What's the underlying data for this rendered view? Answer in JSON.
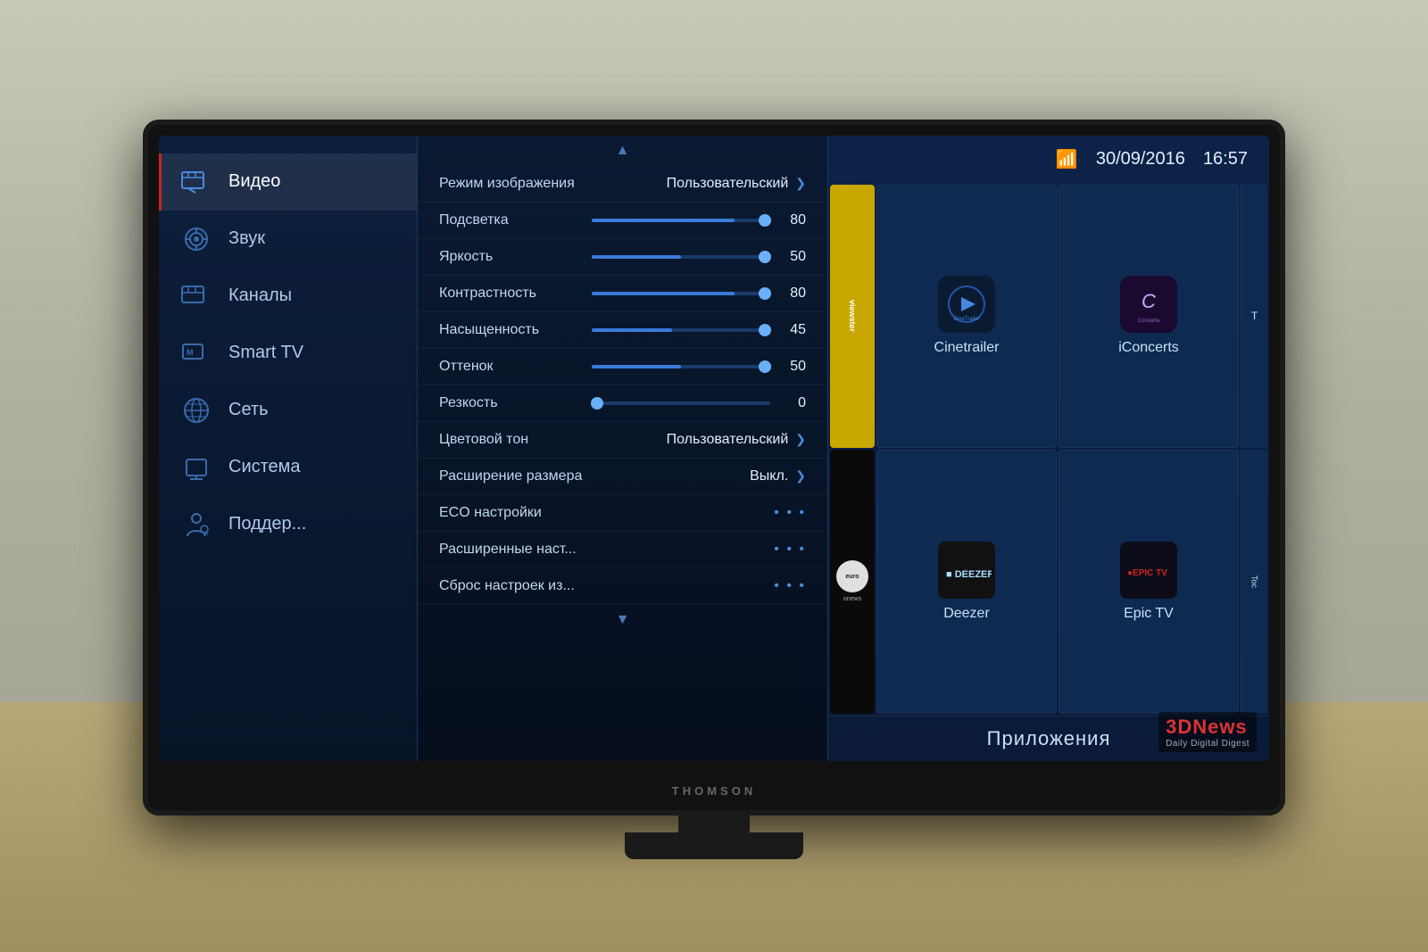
{
  "room": {
    "bg_color": "#9a9a8a",
    "table_color": "#b8a878"
  },
  "tv": {
    "brand": "THOMSON",
    "screen": {
      "sidebar": {
        "items": [
          {
            "id": "video",
            "label": "Видео",
            "active": true
          },
          {
            "id": "sound",
            "label": "Звук",
            "active": false
          },
          {
            "id": "channels",
            "label": "Каналы",
            "active": false
          },
          {
            "id": "smart_tv",
            "label": "Smart TV",
            "active": false
          },
          {
            "id": "network",
            "label": "Сеть",
            "active": false
          },
          {
            "id": "system",
            "label": "Система",
            "active": false
          },
          {
            "id": "support",
            "label": "Поддер...",
            "active": false
          }
        ]
      },
      "settings": {
        "scroll_up": "▲",
        "scroll_down": "▼",
        "items": [
          {
            "id": "image_mode",
            "label": "Режим изображения",
            "value": "Пользовательский",
            "type": "select"
          },
          {
            "id": "backlight",
            "label": "Подсветка",
            "value": "80",
            "type": "slider",
            "fill_pct": 80
          },
          {
            "id": "brightness",
            "label": "Яркость",
            "value": "50",
            "type": "slider",
            "fill_pct": 50
          },
          {
            "id": "contrast",
            "label": "Контрастность",
            "value": "80",
            "type": "slider",
            "fill_pct": 80
          },
          {
            "id": "saturation",
            "label": "Насыщенность",
            "value": "45",
            "type": "slider",
            "fill_pct": 45
          },
          {
            "id": "hue",
            "label": "Оттенок",
            "value": "50",
            "type": "slider",
            "fill_pct": 50
          },
          {
            "id": "sharpness",
            "label": "Резкость",
            "value": "0",
            "type": "slider",
            "fill_pct": 2
          },
          {
            "id": "color_tone",
            "label": "Цветовой тон",
            "value": "Пользовательский",
            "type": "select"
          },
          {
            "id": "size_ext",
            "label": "Расширение размера",
            "value": "Выкл.",
            "type": "select"
          },
          {
            "id": "eco",
            "label": "ECO настройки",
            "value": "...",
            "type": "dots"
          },
          {
            "id": "advanced",
            "label": "Расширенные наст...",
            "value": "...",
            "type": "dots"
          },
          {
            "id": "reset",
            "label": "Сброс настроек из...",
            "value": "...",
            "type": "dots"
          }
        ]
      },
      "smart": {
        "header": {
          "wifi": "📶",
          "date": "30/09/2016",
          "time": "16:57"
        },
        "apps_row1": [
          {
            "id": "viewster",
            "label": "viewster",
            "color": "#c8a800",
            "partial": false
          },
          {
            "id": "cinetrailer",
            "label": "Cinetrailer",
            "color": "#0a1a30"
          },
          {
            "id": "iconcerts",
            "label": "iConcerts",
            "color": "#1a0a30"
          },
          {
            "id": "partial_top",
            "label": "T",
            "partial": true
          }
        ],
        "apps_row2": [
          {
            "id": "euronews",
            "label": "euronews",
            "color": "#111"
          },
          {
            "id": "deezer",
            "label": "Deezer",
            "color": "#111"
          },
          {
            "id": "epictv",
            "label": "Epic TV",
            "color": "#0d0d1a"
          },
          {
            "id": "partial_bottom",
            "label": "Toc",
            "partial": true
          }
        ],
        "bottom_label": "Приложения"
      }
    }
  },
  "watermark": {
    "main": "3DNews",
    "sub": "Daily Digital Digest"
  }
}
